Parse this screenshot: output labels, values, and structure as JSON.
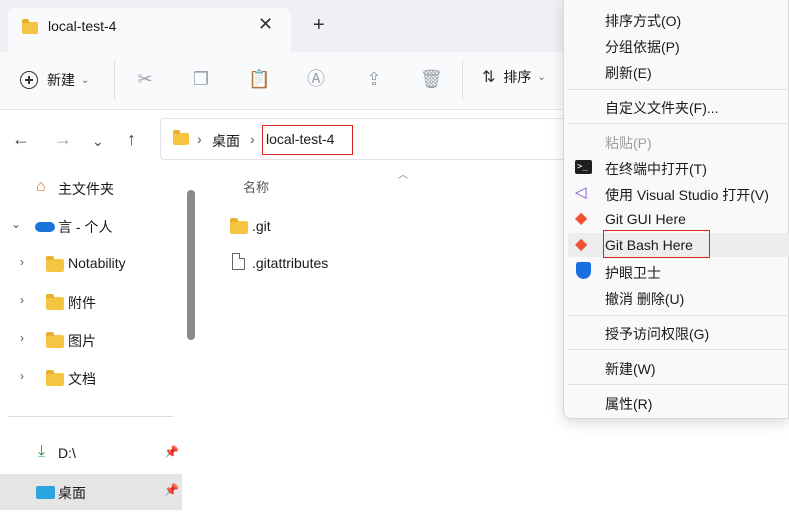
{
  "window": {
    "tab_title": "local-test-4",
    "close_tab": "✕",
    "new_tab": "+"
  },
  "toolbar": {
    "new_label": "新建",
    "sort_label": "排序",
    "icons": [
      "cut-icon",
      "copy-icon",
      "paste-icon",
      "rename-icon",
      "share-icon",
      "delete-icon"
    ]
  },
  "address_bar": {
    "crumbs": [
      "桌面",
      "local-test-4"
    ],
    "separator": "›"
  },
  "sidebar": {
    "items": [
      {
        "label": "主文件夹",
        "icon": "home-icon"
      },
      {
        "label": "言 - 个人",
        "icon": "onedrive-cloud-icon"
      },
      {
        "label": "Notability",
        "icon": "folder-icon"
      },
      {
        "label": "附件",
        "icon": "folder-icon"
      },
      {
        "label": "图片",
        "icon": "folder-icon"
      },
      {
        "label": "文档",
        "icon": "folder-icon"
      },
      {
        "label": "D:\\",
        "icon": "download-arrow-icon"
      },
      {
        "label": "桌面",
        "icon": "desktop-icon"
      }
    ]
  },
  "file_list": {
    "column_name": "名称",
    "files": [
      {
        "name": ".git",
        "type": "folder"
      },
      {
        "name": ".gitattributes",
        "type": "file"
      }
    ]
  },
  "context_menu": {
    "items": [
      {
        "label": "排序方式(O)"
      },
      {
        "label": "分组依据(P)"
      },
      {
        "label": "刷新(E)"
      },
      {
        "label": "自定义文件夹(F)..."
      },
      {
        "label": "粘贴(P)",
        "disabled": true
      },
      {
        "label": "在终端中打开(T)",
        "icon": "terminal-icon"
      },
      {
        "label": "使用 Visual Studio 打开(V)",
        "icon": "visual-studio-icon"
      },
      {
        "label": "Git GUI Here",
        "icon": "git-icon"
      },
      {
        "label": "Git Bash Here",
        "icon": "git-icon",
        "highlighted": true
      },
      {
        "label": "护眼卫士",
        "icon": "shield-icon"
      },
      {
        "label": "撤消 删除(U)"
      },
      {
        "label": "授予访问权限(G)"
      },
      {
        "label": "新建(W)"
      },
      {
        "label": "属性(R)"
      }
    ]
  },
  "colors": {
    "highlight_border": "#dd2222",
    "folder": "#f5c542",
    "vs_purple": "#7b4fc9",
    "git_orange": "#f05033",
    "shield_blue": "#1a6fe0"
  }
}
